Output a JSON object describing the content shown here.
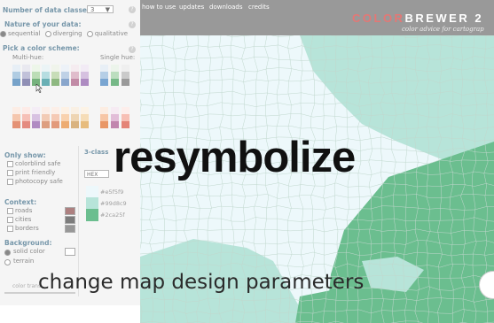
{
  "app": {
    "brand_prefix": "COLOR",
    "brand_suffix": "BREWER 2",
    "tagline": "color advice for cartograp"
  },
  "nav": [
    "how to use",
    "updates",
    "downloads",
    "credits"
  ],
  "panel": {
    "num_classes_label": "Number of data classes:",
    "num_classes_value": "3",
    "nature_label": "Nature of your data:",
    "nature_options": [
      "sequential",
      "diverging",
      "qualitative"
    ],
    "scheme_label": "Pick a color scheme:",
    "multi_hue_label": "Multi-hue:",
    "single_hue_label": "Single hue:",
    "only_show_label": "Only show:",
    "only_show_options": [
      "colorblind safe",
      "print friendly",
      "photocopy safe"
    ],
    "context_label": "Context:",
    "context_options": [
      "roads",
      "cities",
      "borders"
    ],
    "background_label": "Background:",
    "background_options": [
      "solid color",
      "terrain"
    ],
    "color_transparency_label": "color trans",
    "class_label": "3-class",
    "format_value": "HEX",
    "legend": [
      {
        "hex": "#e5f5f9",
        "color": "#e5f5f9"
      },
      {
        "hex": "#99d8c9",
        "color": "#99d8c9"
      },
      {
        "hex": "#2ca25f",
        "color": "#2ca25f"
      }
    ]
  },
  "overlay": {
    "headline": "resymbolize",
    "subline": "change map design parameters"
  },
  "colors": {
    "accent": "#3d6b86",
    "topbar": "#6e6e6e",
    "brand_highlight": "#d93d3a",
    "map_light": "#e5f5f9",
    "map_mid": "#99d8c9",
    "map_dark": "#2ca25f"
  }
}
